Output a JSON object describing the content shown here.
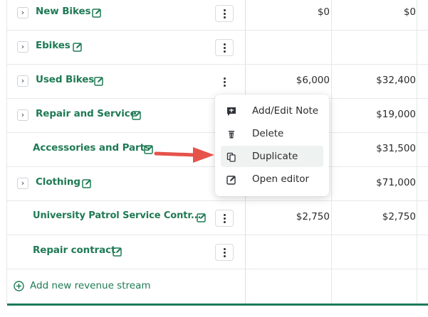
{
  "rows": [
    {
      "label": "New Bikes",
      "has_chevron": true,
      "col1": "$0",
      "col2": "$0"
    },
    {
      "label": "Ebikes",
      "has_chevron": true,
      "col1": "",
      "col2": ""
    },
    {
      "label": "Used Bikes",
      "has_chevron": true,
      "col1": "$6,000",
      "col2": "$32,400"
    },
    {
      "label": "Repair and Service",
      "has_chevron": true,
      "col1": "",
      "col2": "$19,000"
    },
    {
      "label": "Accessories and Parts",
      "has_chevron": false,
      "col1": "",
      "col2": "$31,500"
    },
    {
      "label": "Clothing",
      "has_chevron": true,
      "col1": "",
      "col2": "$71,000"
    },
    {
      "label": "University Patrol Service Contr...",
      "has_chevron": false,
      "col1": "$2,750",
      "col2": "$2,750"
    },
    {
      "label": "Repair contract",
      "has_chevron": false,
      "col1": "",
      "col2": ""
    }
  ],
  "add_stream_label": "Add new revenue stream",
  "context_menu": {
    "items": [
      {
        "label": "Add/Edit Note",
        "icon": "note-icon"
      },
      {
        "label": "Delete",
        "icon": "trash-icon"
      },
      {
        "label": "Duplicate",
        "icon": "duplicate-icon",
        "highlighted": true
      },
      {
        "label": "Open editor",
        "icon": "edit-icon"
      }
    ]
  },
  "colors": {
    "accent": "#1f7a55",
    "annotation_arrow": "#e5534b",
    "menu_hover": "#eef2f1"
  }
}
